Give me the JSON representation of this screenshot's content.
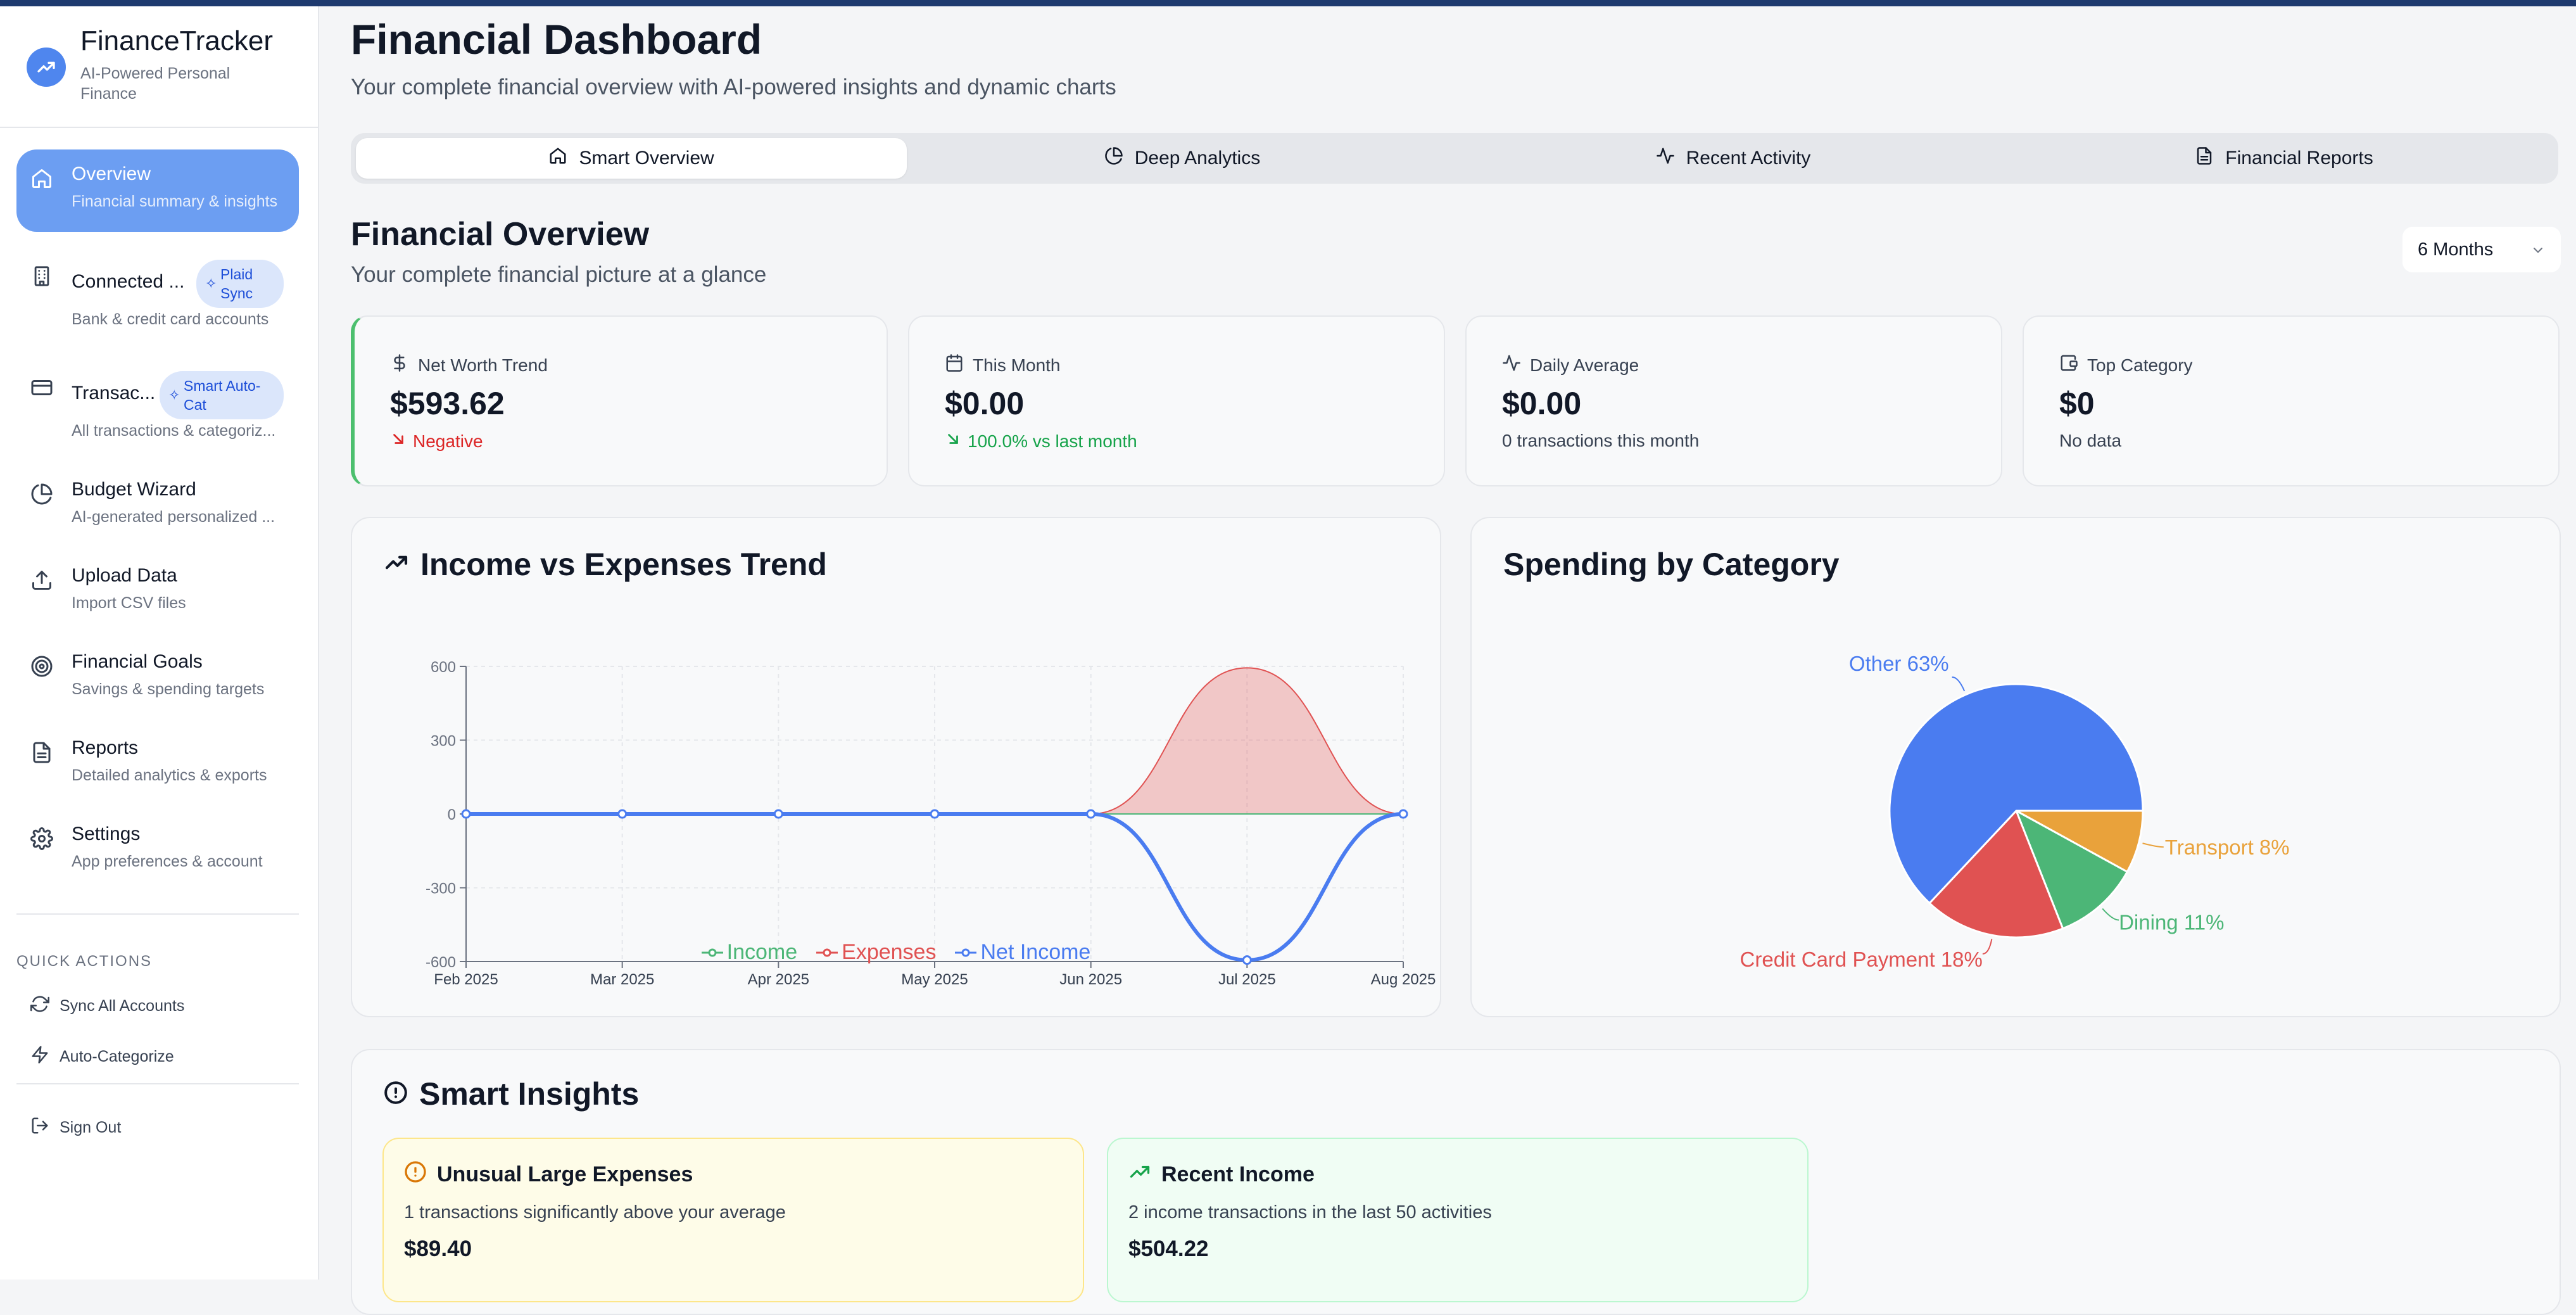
{
  "colors": {
    "primary": "#4f86ee",
    "active_nav": "#6c9ef2",
    "income": "#4cb677",
    "expenses": "#e05252",
    "net": "#4a7cf0",
    "transport": "#e9a23b"
  },
  "sidebar": {
    "brand_title": "FinanceTracker",
    "brand_sub": "AI-Powered Personal Finance",
    "brand_icon": "trending-up-icon",
    "items": [
      {
        "label": "Overview",
        "desc": "Financial summary & insights",
        "icon": "home-icon"
      },
      {
        "label": "Connected ...",
        "desc": "Bank & credit card accounts",
        "icon": "building-icon",
        "badge": "Plaid Sync"
      },
      {
        "label": "Transac...",
        "desc": "All transactions & categoriz...",
        "icon": "credit-card-icon",
        "badge": "Smart Auto-Cat"
      },
      {
        "label": "Budget Wizard",
        "desc": "AI-generated personalized ...",
        "icon": "pie-chart-icon"
      },
      {
        "label": "Upload Data",
        "desc": "Import CSV files",
        "icon": "upload-icon"
      },
      {
        "label": "Financial Goals",
        "desc": "Savings & spending targets",
        "icon": "target-icon"
      },
      {
        "label": "Reports",
        "desc": "Detailed analytics & exports",
        "icon": "file-text-icon"
      },
      {
        "label": "Settings",
        "desc": "App preferences & account",
        "icon": "gear-icon"
      }
    ],
    "quick_actions_heading": "QUICK ACTIONS",
    "quick_actions": [
      {
        "label": "Sync All Accounts",
        "icon": "refresh-icon"
      },
      {
        "label": "Auto-Categorize",
        "icon": "lightning-icon"
      }
    ],
    "sign_out": "Sign Out"
  },
  "header": {
    "title": "Financial Dashboard",
    "subtitle": "Your complete financial overview with AI-powered insights and dynamic charts"
  },
  "tabs": [
    {
      "label": "Smart Overview",
      "icon": "home-icon"
    },
    {
      "label": "Deep Analytics",
      "icon": "pie-chart-icon"
    },
    {
      "label": "Recent Activity",
      "icon": "activity-icon"
    },
    {
      "label": "Financial Reports",
      "icon": "file-text-icon"
    }
  ],
  "overview": {
    "title": "Financial Overview",
    "subtitle": "Your complete financial picture at a glance",
    "period": "6 Months"
  },
  "stats": [
    {
      "label": "Net Worth Trend",
      "value": "$593.62",
      "note": "Negative",
      "note_color": "#dc2626",
      "icon": "dollar-icon"
    },
    {
      "label": "This Month",
      "value": "$0.00",
      "note": "100.0% vs last month",
      "note_color": "#16a34a",
      "icon": "calendar-icon"
    },
    {
      "label": "Daily Average",
      "value": "$0.00",
      "note": "0 transactions this month",
      "note_color": "#374151",
      "icon": "activity-icon"
    },
    {
      "label": "Top Category",
      "value": "$0",
      "note": "No data",
      "note_color": "#374151",
      "icon": "wallet-icon"
    }
  ],
  "trend_panel_title": "Income vs Expenses Trend",
  "category_panel_title": "Spending by Category",
  "chart_data": [
    {
      "type": "line",
      "title": "Income vs Expenses Trend",
      "x": [
        "Feb 2025",
        "Mar 2025",
        "Apr 2025",
        "May 2025",
        "Jun 2025",
        "Jul 2025",
        "Aug 2025"
      ],
      "yticks": [
        600,
        300,
        0,
        -300,
        -600
      ],
      "ylim": [
        -600,
        600
      ],
      "series": [
        {
          "name": "Income",
          "values": [
            0,
            0,
            0,
            0,
            0,
            0,
            0
          ]
        },
        {
          "name": "Expenses",
          "values": [
            0,
            0,
            0,
            0,
            0,
            594,
            0
          ]
        },
        {
          "name": "Net Income",
          "values": [
            0,
            0,
            0,
            0,
            0,
            -594,
            0
          ]
        }
      ],
      "legend": "bottom",
      "grid": true
    },
    {
      "type": "pie",
      "title": "Spending by Category",
      "slices": [
        {
          "label": "Other 63%",
          "value": 63,
          "color": "#4a7cf0"
        },
        {
          "label": "Credit Card Payment 18%",
          "value": 18,
          "color": "#e05252"
        },
        {
          "label": "Dining 11%",
          "value": 11,
          "color": "#4cb677"
        },
        {
          "label": "Transport 8%",
          "value": 8,
          "color": "#e9a23b"
        }
      ]
    }
  ],
  "insights": {
    "title": "Smart Insights",
    "cards": [
      {
        "title": "Unusual Large Expenses",
        "desc": "1 transactions significantly above your average",
        "amount": "$89.40",
        "icon": "alert-circle-icon"
      },
      {
        "title": "Recent Income",
        "desc": "2 income transactions in the last 50 activities",
        "amount": "$504.22",
        "icon": "trending-up-icon"
      }
    ]
  }
}
